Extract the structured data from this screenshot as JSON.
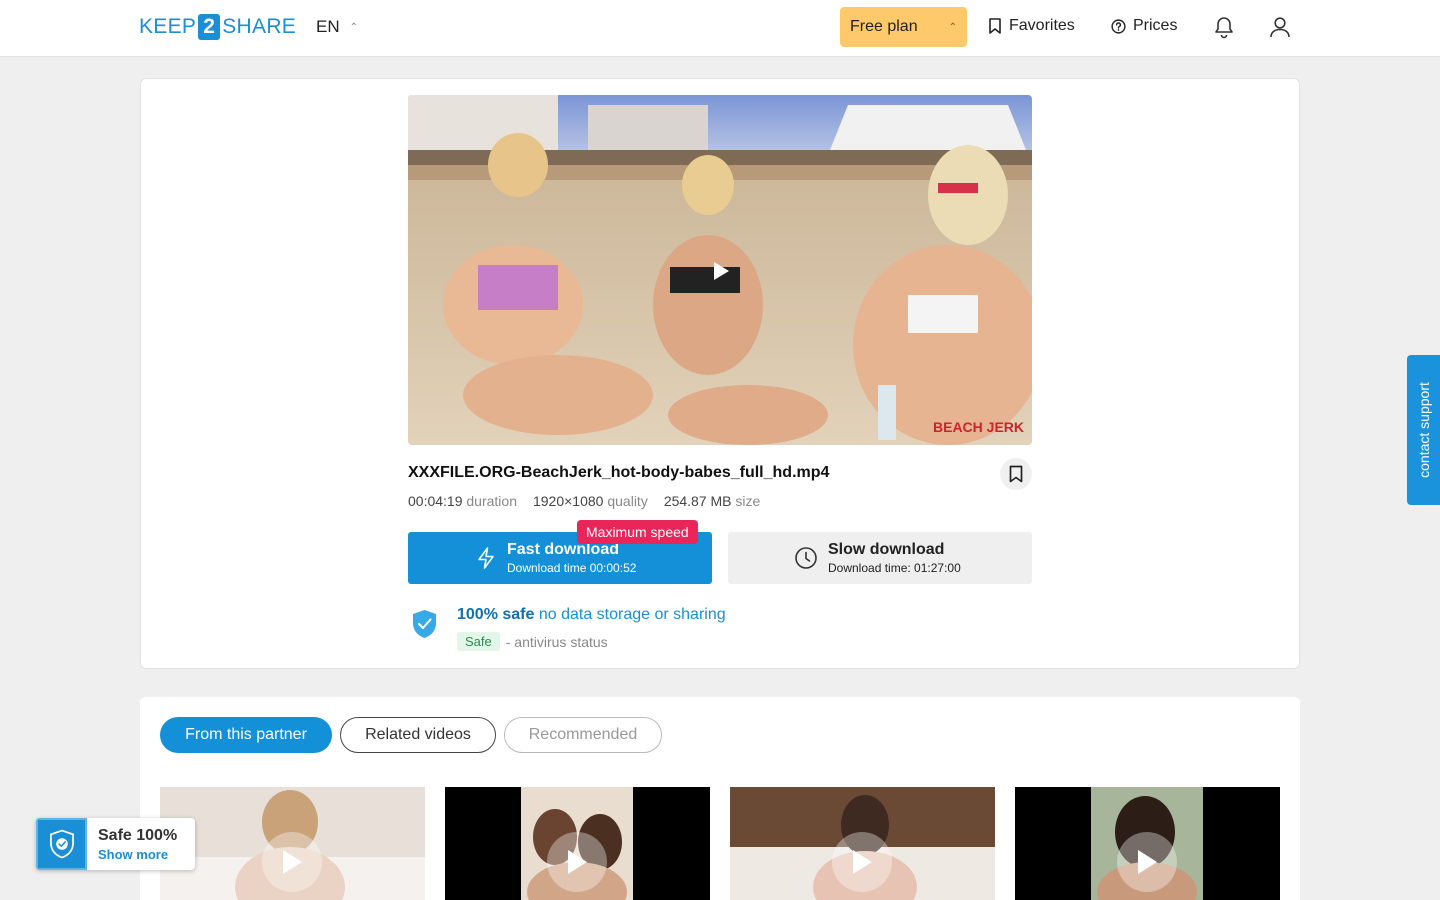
{
  "header": {
    "logo_left": "KEEP",
    "logo_mid": "2",
    "logo_right": "SHARE",
    "language": "EN",
    "plan_label": "Free plan",
    "favorites_label": "Favorites",
    "prices_label": "Prices"
  },
  "file": {
    "name": "XXXFILE.ORG-BeachJerk_hot-body-babes_full_hd.mp4",
    "duration_value": "00:04:19",
    "duration_label": "duration",
    "quality_value": "1920×1080",
    "quality_label": "quality",
    "size_value": "254.87 MB",
    "size_label": "size",
    "video_watermark": "BEACH JERK"
  },
  "download": {
    "max_speed_badge": "Maximum speed",
    "fast_title": "Fast download",
    "fast_sub": "Download time 00:00:52",
    "slow_title": "Slow download",
    "slow_sub": "Download time: 01:27:00"
  },
  "security": {
    "safe_bold": "100% safe",
    "safe_rest": " no data storage or sharing",
    "av_badge": "Safe",
    "av_text": "- antivirus status"
  },
  "tabs": [
    {
      "label": "From this partner",
      "state": "active"
    },
    {
      "label": "Related videos",
      "state": "normal"
    },
    {
      "label": "Recommended",
      "state": "disabled"
    }
  ],
  "support_label": "contact support",
  "safe_widget": {
    "title": "Safe 100%",
    "link": "Show more"
  },
  "colors": {
    "brand_blue": "#1490d8",
    "plan_yellow": "#fdc96b",
    "badge_red": "#e8265a"
  }
}
